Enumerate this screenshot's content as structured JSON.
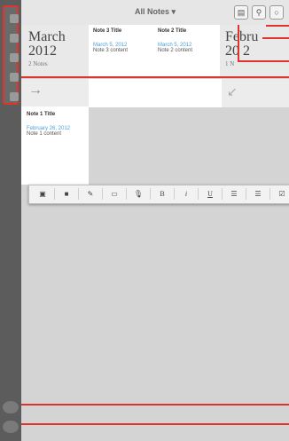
{
  "topbar": {
    "title": "All Notes ▾"
  },
  "icons": {
    "new_note": "new-note-icon",
    "location": "location-pin-icon",
    "search": "search-icon",
    "forward": "→",
    "collapse": "↙"
  },
  "months": [
    {
      "name": "March",
      "year": "2012",
      "count": "2 Notes"
    },
    {
      "name": "Febru",
      "year": "20  2",
      "count": "1 N"
    }
  ],
  "notes": [
    {
      "title": "Note 3 Title",
      "date": "March 5, 2012",
      "content": "Note 3 content"
    },
    {
      "title": "Note 2 Title",
      "date": "March 5, 2012",
      "content": "Note 2 content"
    },
    {
      "title": "Note 1 Title",
      "date": "February 26, 2012",
      "content": "Note 1 content"
    }
  ],
  "toolbar": {
    "items": [
      "▣",
      "■",
      "✎",
      "▭",
      "🎙",
      "B",
      "i",
      "U",
      "☰",
      "☰",
      "☑"
    ]
  },
  "colors": {
    "callout": "#e0342a",
    "date_blue": "#4a9fd8"
  }
}
